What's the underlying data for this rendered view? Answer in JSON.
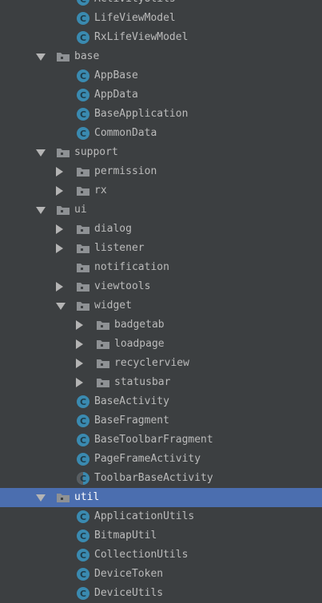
{
  "colors": {
    "background": "#3c3f41",
    "selection": "#4b6eaf",
    "text": "#bbbbbb",
    "class_icon": "#3a8ab0",
    "folder_icon": "#8e9194"
  },
  "tree": [
    {
      "label": "ActivityUtils",
      "depth": 3,
      "kind": "class",
      "arrow": "none"
    },
    {
      "label": "LifeViewModel",
      "depth": 3,
      "kind": "class",
      "arrow": "none"
    },
    {
      "label": "RxLifeViewModel",
      "depth": 3,
      "kind": "class",
      "arrow": "none"
    },
    {
      "label": "base",
      "depth": 2,
      "kind": "package",
      "arrow": "expanded"
    },
    {
      "label": "AppBase",
      "depth": 3,
      "kind": "class",
      "arrow": "none"
    },
    {
      "label": "AppData",
      "depth": 3,
      "kind": "class",
      "arrow": "none"
    },
    {
      "label": "BaseApplication",
      "depth": 3,
      "kind": "class",
      "arrow": "none"
    },
    {
      "label": "CommonData",
      "depth": 3,
      "kind": "class",
      "arrow": "none"
    },
    {
      "label": "support",
      "depth": 2,
      "kind": "package",
      "arrow": "expanded"
    },
    {
      "label": "permission",
      "depth": 3,
      "kind": "package",
      "arrow": "collapsed"
    },
    {
      "label": "rx",
      "depth": 3,
      "kind": "package",
      "arrow": "collapsed"
    },
    {
      "label": "ui",
      "depth": 2,
      "kind": "package",
      "arrow": "expanded"
    },
    {
      "label": "dialog",
      "depth": 3,
      "kind": "package",
      "arrow": "collapsed"
    },
    {
      "label": "listener",
      "depth": 3,
      "kind": "package",
      "arrow": "collapsed"
    },
    {
      "label": "notification",
      "depth": 3,
      "kind": "package",
      "arrow": "none"
    },
    {
      "label": "viewtools",
      "depth": 3,
      "kind": "package",
      "arrow": "collapsed"
    },
    {
      "label": "widget",
      "depth": 3,
      "kind": "package",
      "arrow": "expanded"
    },
    {
      "label": "badgetab",
      "depth": 4,
      "kind": "package",
      "arrow": "collapsed"
    },
    {
      "label": "loadpage",
      "depth": 4,
      "kind": "package",
      "arrow": "collapsed"
    },
    {
      "label": "recyclerview",
      "depth": 4,
      "kind": "package",
      "arrow": "collapsed"
    },
    {
      "label": "statusbar",
      "depth": 4,
      "kind": "package",
      "arrow": "collapsed"
    },
    {
      "label": "BaseActivity",
      "depth": 3,
      "kind": "class",
      "arrow": "none"
    },
    {
      "label": "BaseFragment",
      "depth": 3,
      "kind": "class",
      "arrow": "none"
    },
    {
      "label": "BaseToolbarFragment",
      "depth": 3,
      "kind": "class",
      "arrow": "none"
    },
    {
      "label": "PageFrameActivity",
      "depth": 3,
      "kind": "class",
      "arrow": "none"
    },
    {
      "label": "ToolbarBaseActivity",
      "depth": 3,
      "kind": "abstract-class",
      "arrow": "none"
    },
    {
      "label": "util",
      "depth": 2,
      "kind": "package",
      "arrow": "expanded",
      "selected": true
    },
    {
      "label": "ApplicationUtils",
      "depth": 3,
      "kind": "class",
      "arrow": "none"
    },
    {
      "label": "BitmapUtil",
      "depth": 3,
      "kind": "class",
      "arrow": "none"
    },
    {
      "label": "CollectionUtils",
      "depth": 3,
      "kind": "class",
      "arrow": "none"
    },
    {
      "label": "DeviceToken",
      "depth": 3,
      "kind": "class",
      "arrow": "none"
    },
    {
      "label": "DeviceUtils",
      "depth": 3,
      "kind": "class",
      "arrow": "none"
    }
  ]
}
